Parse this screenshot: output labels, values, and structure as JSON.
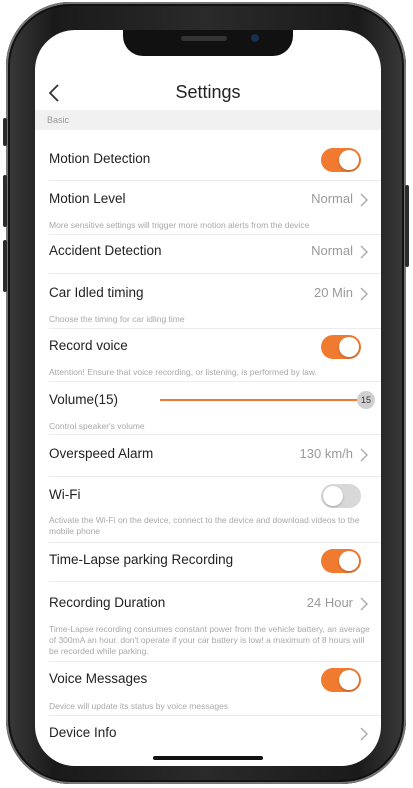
{
  "header": {
    "title": "Settings"
  },
  "section": {
    "basic": "Basic"
  },
  "settings": {
    "motion_detection": {
      "label": "Motion Detection",
      "enabled": true
    },
    "motion_level": {
      "label": "Motion Level",
      "value": "Normal",
      "desc": "More sensitive settings will trigger more motion alerts from the device"
    },
    "accident_detection": {
      "label": "Accident Detection",
      "value": "Normal"
    },
    "car_idled": {
      "label": "Car Idled timing",
      "value": "20 Min",
      "desc": "Choose the timing for car idling time"
    },
    "record_voice": {
      "label": "Record voice",
      "enabled": true,
      "desc": "Attention! Ensure that voice recording, or listening, is performed by law."
    },
    "volume": {
      "label": "Volume(15)",
      "value": "15",
      "level": 15,
      "desc": "Control speaker's volume"
    },
    "overspeed_alarm": {
      "label": "Overspeed Alarm",
      "value": "130 km/h"
    },
    "wifi": {
      "label": "Wi-Fi",
      "enabled": false,
      "desc": "Activate the Wi-Fi on the device, connect to the device and download videos to the mobile phone"
    },
    "timelapse": {
      "label": "Time-Lapse parking Recording",
      "enabled": true
    },
    "recording_duration": {
      "label": "Recording Duration",
      "value": "24 Hour",
      "desc": "Time-Lapse recording consumes constant power from the vehicle battery, an average of 300mA an hour. don't operate if your car battery is low! a maximum of 8 hours will be recorded while parking."
    },
    "voice_messages": {
      "label": "Voice Messages",
      "enabled": true,
      "desc": "Device will update its status by voice messages"
    },
    "device_info": {
      "label": "Device Info"
    }
  },
  "colors": {
    "accent": "#f07a30",
    "toggle_off": "#d8d8d8",
    "text": "#222222",
    "muted": "#9a9a9a"
  }
}
